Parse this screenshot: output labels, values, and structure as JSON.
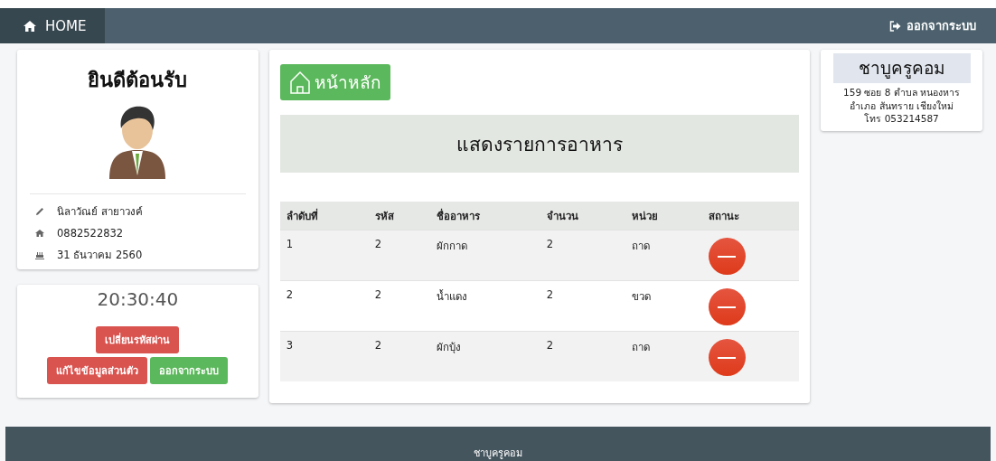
{
  "navbar": {
    "home_label": "HOME",
    "logout_label": "ออกจากระบบ"
  },
  "profile": {
    "title": "ยินดีต้อนรับ",
    "name": "นิลาวัณย์ สายาวงค์",
    "phone": "0882522832",
    "date": "31 ธันวาคม 2560"
  },
  "clock": {
    "time": "20:30:40",
    "buttons": [
      {
        "label": "เปลี่ยนรหัสผ่าน",
        "kind": "danger"
      },
      {
        "label": "แก้ไขข้อมูลส่วนตัว",
        "kind": "danger"
      },
      {
        "label": "ออกจากระบบ",
        "kind": "success"
      }
    ]
  },
  "main": {
    "home_button": "หน้าหลัก",
    "heading": "แสดงรายการอาหาร",
    "table": {
      "columns": [
        "ลำดับที่",
        "รหัส",
        "ชื่ออาหาร",
        "จำนวน",
        "หน่วย",
        "สถานะ"
      ],
      "rows": [
        [
          "1",
          "2",
          "ผักกาด",
          "2",
          "ถาด"
        ],
        [
          "2",
          "2",
          "น้ำแดง",
          "2",
          "ขวด"
        ],
        [
          "3",
          "2",
          "ผักบุ้ง",
          "2",
          "ถาด"
        ]
      ]
    }
  },
  "shop": {
    "name": "ชาบูครูคอม",
    "address_lines": [
      "159 ซอย 8 ตำบล หนองหาร",
      "อำเภอ สันทราย เชียงใหม่",
      "โทร 053214587"
    ]
  },
  "footer": {
    "name": "ชาบูครูคอม"
  }
}
